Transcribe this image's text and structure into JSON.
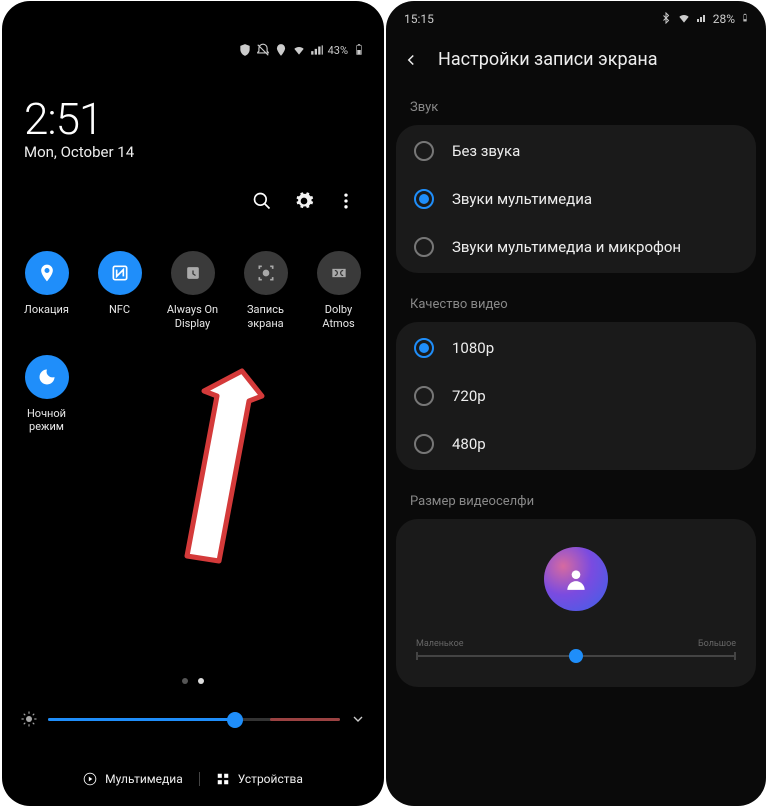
{
  "left": {
    "status": {
      "battery_pct": "43%"
    },
    "time": "2:51",
    "date": "Mon, October 14",
    "qs": [
      {
        "label": "Локация",
        "on": true,
        "icon": "location"
      },
      {
        "label": "NFC",
        "on": true,
        "icon": "nfc"
      },
      {
        "label": "Always On\nDisplay",
        "on": false,
        "icon": "aod"
      },
      {
        "label": "Запись\nэкрана",
        "on": false,
        "icon": "screen-record"
      },
      {
        "label": "Dolby\nAtmos",
        "on": false,
        "icon": "dolby"
      },
      {
        "label": "Ночной\nрежим",
        "on": true,
        "icon": "moon"
      }
    ],
    "brightness_pct": 64,
    "bottom": {
      "media": "Мультимедиа",
      "devices": "Устройства"
    }
  },
  "right": {
    "status": {
      "time": "15:15",
      "battery_pct": "28%"
    },
    "header": "Настройки записи экрана",
    "sections": {
      "sound": {
        "label": "Звук",
        "options": [
          {
            "label": "Без звука",
            "checked": false
          },
          {
            "label": "Звуки мультимедиа",
            "checked": true
          },
          {
            "label": "Звуки мультимедиа и микрофон",
            "checked": false
          }
        ]
      },
      "quality": {
        "label": "Качество видео",
        "options": [
          {
            "label": "1080p",
            "checked": true
          },
          {
            "label": "720p",
            "checked": false
          },
          {
            "label": "480p",
            "checked": false
          }
        ]
      },
      "selfie": {
        "label": "Размер видеоселфи",
        "min_label": "Маленькое",
        "max_label": "Большое",
        "value_pct": 50
      }
    }
  }
}
